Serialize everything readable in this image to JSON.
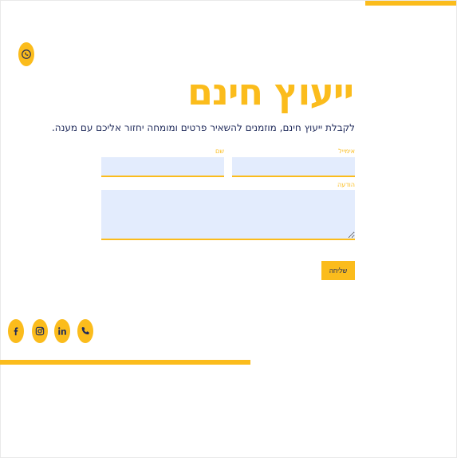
{
  "form": {
    "title": "ייעוץ חינם",
    "subtitle": "לקבלת ייעוץ חינם, מוזמנים להשאיר פרטים ומומחה יחזור אליכם עם מענה.",
    "email_label": "אימייל",
    "name_label": "שם",
    "message_label": "הודעה",
    "submit_label": "שליחה"
  },
  "icons": {
    "top": "whatsapp-icon",
    "social": [
      "facebook-icon",
      "instagram-icon",
      "linkedin-icon",
      "phone-icon"
    ]
  },
  "colors": {
    "accent": "#fbbc1c",
    "text": "#1f2a5a",
    "field_bg": "#e3ecfd"
  }
}
